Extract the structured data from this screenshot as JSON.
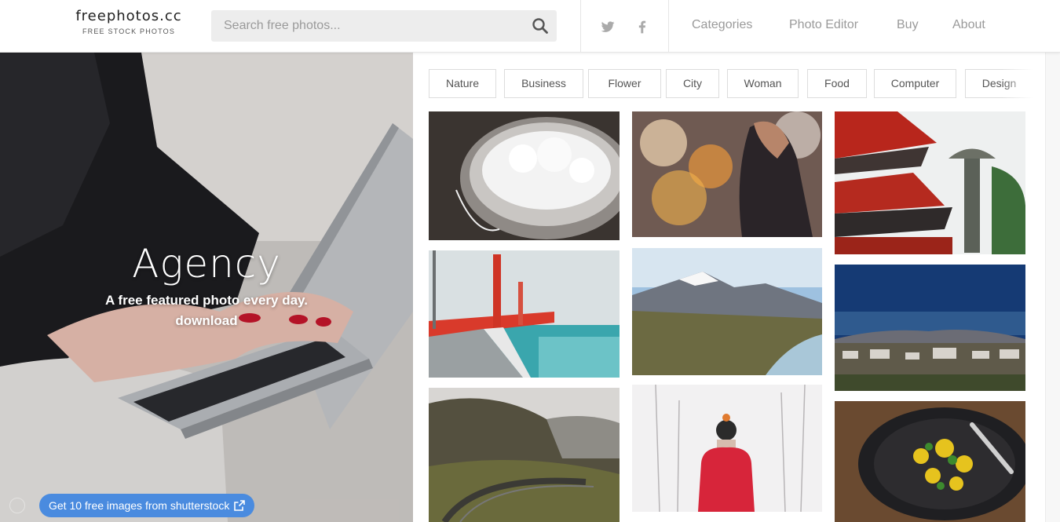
{
  "header": {
    "logo_text": "freephotos.cc",
    "logo_tagline": "FREE STOCK PHOTOS",
    "search_placeholder": "Search free photos...",
    "nav": [
      "Categories",
      "Photo Editor",
      "Buy",
      "About"
    ]
  },
  "hero": {
    "title": "Agency",
    "subtitle": "A free featured photo every day.",
    "link": "download",
    "promo": "Get 10 free images from shutterstock"
  },
  "categories": [
    "Nature",
    "Business",
    "Flower",
    "City",
    "Woman",
    "Food",
    "Computer",
    "Design"
  ],
  "icons": {
    "search": "search-icon",
    "twitter": "twitter-icon",
    "facebook": "facebook-icon",
    "external": "external-link-icon"
  },
  "colors": {
    "promo": "#4a8bdf",
    "accent_red": "#d93a2b"
  }
}
